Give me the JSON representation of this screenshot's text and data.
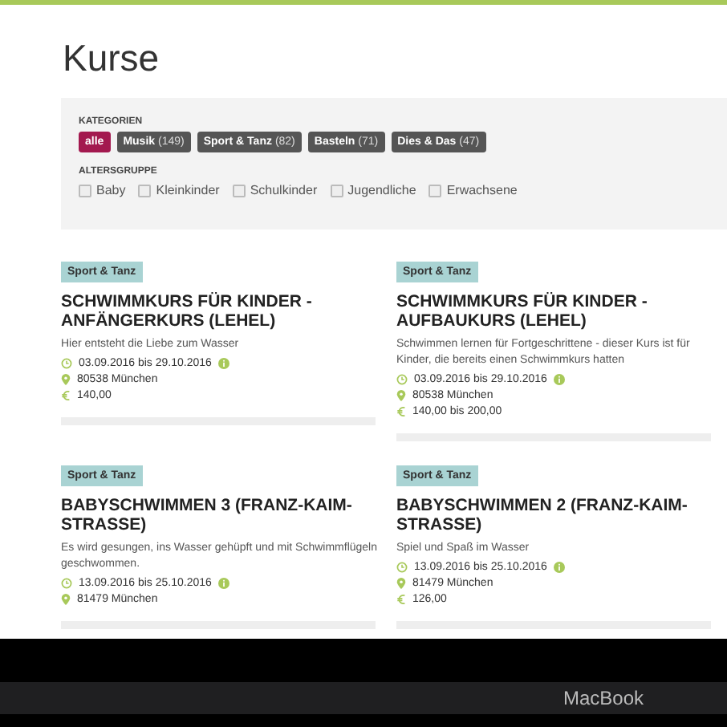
{
  "page": {
    "title": "Kurse"
  },
  "filters": {
    "categories_label": "KATEGORIEN",
    "categories": [
      {
        "label": "alle",
        "selected": true
      },
      {
        "label": "Musik",
        "count": "(149)",
        "selected": false
      },
      {
        "label": "Sport & Tanz",
        "count": "(82)",
        "selected": false
      },
      {
        "label": "Basteln",
        "count": "(71)",
        "selected": false
      },
      {
        "label": "Dies & Das",
        "count": "(47)",
        "selected": false
      }
    ],
    "age_label": "ALTERSGRUPPE",
    "age_groups": [
      {
        "label": "Baby",
        "checked": false
      },
      {
        "label": "Kleinkinder",
        "checked": false
      },
      {
        "label": "Schulkinder",
        "checked": false
      },
      {
        "label": "Jugendliche",
        "checked": false
      },
      {
        "label": "Erwachsene",
        "checked": false
      }
    ]
  },
  "courses": [
    {
      "tag": "Sport & Tanz",
      "title": "SCHWIMMKURS FÜR KINDER - ANFÄNGERKURS (LEHEL)",
      "description": "Hier entsteht die Liebe zum Wasser",
      "dates": "03.09.2016 bis 29.10.2016",
      "location": "80538 München",
      "price": "140,00"
    },
    {
      "tag": "Sport & Tanz",
      "title": "SCHWIMMKURS FÜR KINDER - AUFBAUKURS (LEHEL)",
      "description": "Schwimmen lernen für Fortgeschrittene - dieser Kurs ist für Kinder, die bereits einen Schwimmkurs hatten",
      "dates": "03.09.2016 bis 29.10.2016",
      "location": "80538 München",
      "price": "140,00 bis 200,00"
    },
    {
      "tag": "Sport & Tanz",
      "title": "BABYSCHWIMMEN 3 (FRANZ-KAIM-STRASSE)",
      "description": "Es wird gesungen, ins Wasser gehüpft und mit Schwimmflügeln geschwommen.",
      "dates": "13.09.2016 bis 25.10.2016",
      "location": "81479 München"
    },
    {
      "tag": "Sport & Tanz",
      "title": "BABYSCHWIMMEN 2 (FRANZ-KAIM-STRASSE)",
      "description": "Spiel und Spaß im Wasser",
      "dates": "13.09.2016 bis 25.10.2016",
      "location": "81479 München",
      "price": "126,00"
    }
  ],
  "device": {
    "label": "MacBook"
  }
}
